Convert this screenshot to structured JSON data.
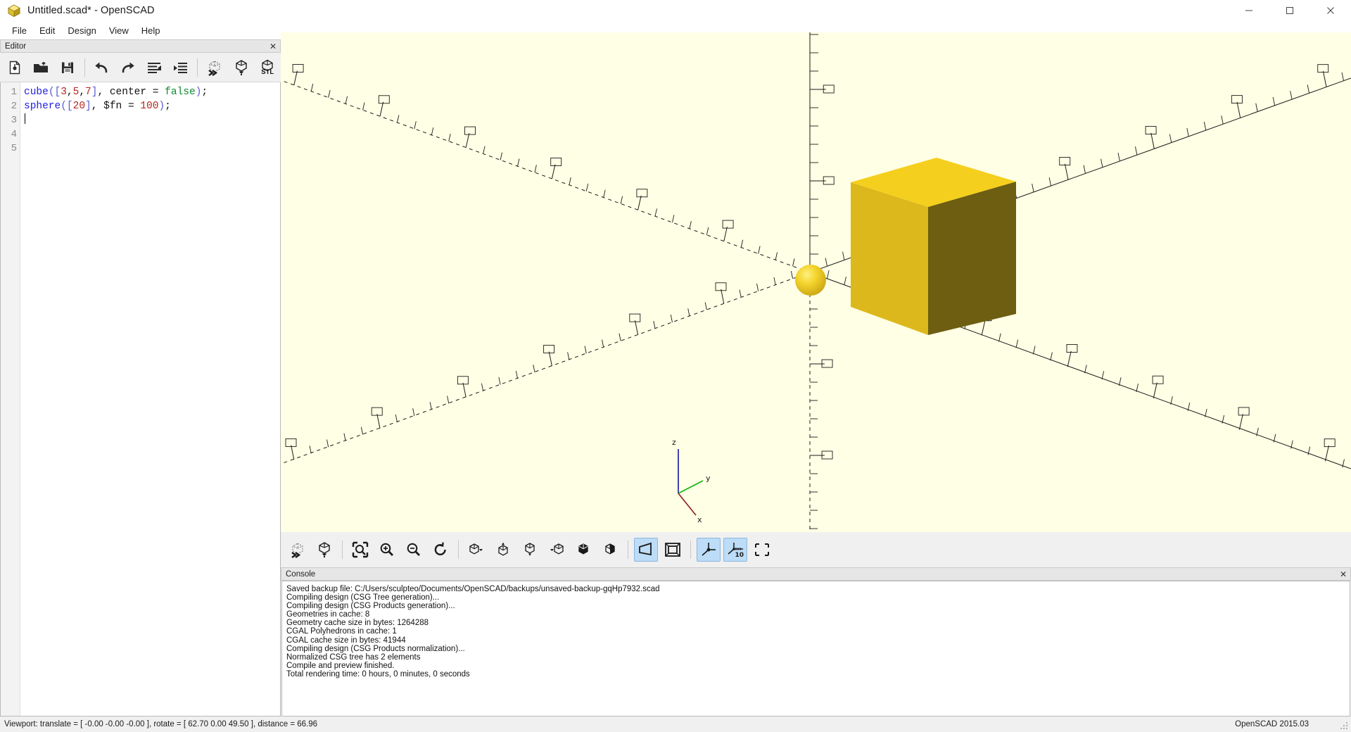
{
  "window": {
    "title": "Untitled.scad* - OpenSCAD",
    "app_icon": "openscad-logo-icon",
    "minimize_label": "—",
    "maximize_label": "☐",
    "close_label": "✕"
  },
  "menubar": {
    "items": [
      {
        "label": "File"
      },
      {
        "label": "Edit"
      },
      {
        "label": "Design"
      },
      {
        "label": "View"
      },
      {
        "label": "Help"
      }
    ]
  },
  "editor": {
    "panel_title": "Editor",
    "close_label": "✕",
    "toolbar": [
      {
        "name": "new-document-button",
        "tooltip": "New"
      },
      {
        "name": "open-folder-button",
        "tooltip": "Open"
      },
      {
        "name": "save-button",
        "tooltip": "Save"
      },
      {
        "name": "undo-button",
        "tooltip": "Undo"
      },
      {
        "name": "redo-button",
        "tooltip": "Redo"
      },
      {
        "name": "unindent-button",
        "tooltip": "Unindent"
      },
      {
        "name": "indent-button",
        "tooltip": "Indent"
      },
      {
        "name": "preview-button",
        "tooltip": "Preview"
      },
      {
        "name": "render-button",
        "tooltip": "Render"
      },
      {
        "name": "export-stl-button",
        "tooltip": "Export as STL",
        "label": "STL"
      }
    ],
    "line_numbers": [
      "1",
      "2",
      "3",
      "4",
      "5"
    ],
    "code_lines": [
      {
        "tokens": [
          {
            "t": "cube",
            "c": "func"
          },
          {
            "t": "(",
            "c": "paren"
          },
          {
            "t": "[",
            "c": "paren"
          },
          {
            "t": "3",
            "c": "num"
          },
          {
            "t": ",",
            "c": "plain"
          },
          {
            "t": "5",
            "c": "num"
          },
          {
            "t": ",",
            "c": "plain"
          },
          {
            "t": "7",
            "c": "num"
          },
          {
            "t": "]",
            "c": "paren"
          },
          {
            "t": ", ",
            "c": "plain"
          },
          {
            "t": "center",
            "c": "plain"
          },
          {
            "t": " = ",
            "c": "plain"
          },
          {
            "t": "false",
            "c": "bool"
          },
          {
            "t": ")",
            "c": "paren"
          },
          {
            "t": ";",
            "c": "plain"
          }
        ]
      },
      {
        "tokens": [
          {
            "t": "sphere",
            "c": "func"
          },
          {
            "t": "(",
            "c": "paren"
          },
          {
            "t": "[",
            "c": "paren"
          },
          {
            "t": "20",
            "c": "num"
          },
          {
            "t": "]",
            "c": "paren"
          },
          {
            "t": ", ",
            "c": "plain"
          },
          {
            "t": "$fn",
            "c": "var"
          },
          {
            "t": " = ",
            "c": "plain"
          },
          {
            "t": "100",
            "c": "num"
          },
          {
            "t": ")",
            "c": "paren"
          },
          {
            "t": ";",
            "c": "plain"
          }
        ]
      },
      {
        "tokens": [],
        "caret": true
      },
      {
        "tokens": []
      },
      {
        "tokens": []
      }
    ],
    "plain_text": "cube([3,5,7], center = false);\nsphere([20], $fn = 100);"
  },
  "viewport": {
    "background_color": "#ffffe5",
    "cube_top_color": "#f5cf1e",
    "cube_left_color": "#dcb81c",
    "cube_right_color": "#6e5e12",
    "sphere_color": "#f2d028",
    "axis_x_color": "#8b1a1a",
    "axis_y_color": "#11b511",
    "axis_z_color": "#1414aa",
    "axis_labels": {
      "x": "x",
      "y": "y",
      "z": "z"
    }
  },
  "view_toolbar": {
    "buttons": [
      {
        "name": "preview-button",
        "tooltip": "Preview",
        "active": false
      },
      {
        "name": "render-button",
        "tooltip": "Render",
        "active": false
      },
      {
        "name": "view-all-button",
        "tooltip": "View All",
        "active": false
      },
      {
        "name": "zoom-in-button",
        "tooltip": "Zoom In",
        "active": false
      },
      {
        "name": "zoom-out-button",
        "tooltip": "Zoom Out",
        "active": false
      },
      {
        "name": "reset-view-button",
        "tooltip": "Reset View",
        "active": false
      },
      {
        "name": "right-view-button",
        "tooltip": "Right View",
        "active": false
      },
      {
        "name": "top-view-button",
        "tooltip": "Top View",
        "active": false
      },
      {
        "name": "bottom-view-button",
        "tooltip": "Bottom View",
        "active": false
      },
      {
        "name": "left-view-button",
        "tooltip": "Left View",
        "active": false
      },
      {
        "name": "front-view-button",
        "tooltip": "Front View",
        "active": false
      },
      {
        "name": "back-view-button",
        "tooltip": "Back View",
        "active": false
      },
      {
        "name": "perspective-view-button",
        "tooltip": "Perspective",
        "active": true
      },
      {
        "name": "orthogonal-view-button",
        "tooltip": "Orthogonal",
        "active": false
      },
      {
        "name": "show-axes-button",
        "tooltip": "Show Axes",
        "active": true
      },
      {
        "name": "show-scale-markers-button",
        "tooltip": "Show Scale Markers",
        "label": "10",
        "active": true
      },
      {
        "name": "show-edges-button",
        "tooltip": "Show Edges",
        "active": false
      }
    ]
  },
  "console": {
    "panel_title": "Console",
    "close_label": "✕",
    "lines": [
      "Saved backup file: C:/Users/sculpteo/Documents/OpenSCAD/backups/unsaved-backup-gqHp7932.scad",
      "Compiling design (CSG Tree generation)...",
      "Compiling design (CSG Products generation)...",
      "Geometries in cache: 8",
      "Geometry cache size in bytes: 1264288",
      "CGAL Polyhedrons in cache: 1",
      "CGAL cache size in bytes: 41944",
      "Compiling design (CSG Products normalization)...",
      "Normalized CSG tree has 2 elements",
      "Compile and preview finished.",
      "Total rendering time: 0 hours, 0 minutes, 0 seconds"
    ]
  },
  "statusbar": {
    "viewport_info": "Viewport: translate = [ -0.00 -0.00 -0.00 ], rotate = [ 62.70 0.00 49.50 ], distance = 66.96",
    "version": "OpenSCAD 2015.03"
  }
}
